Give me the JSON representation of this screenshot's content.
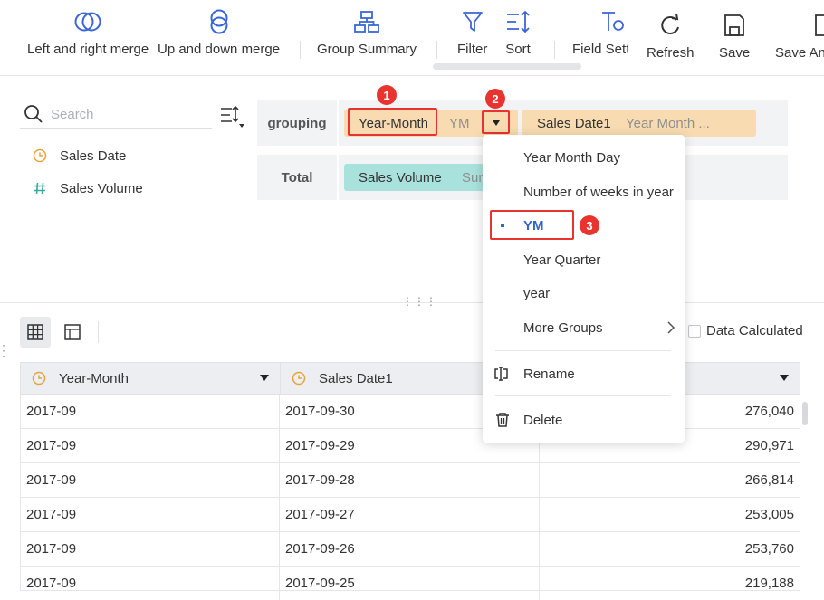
{
  "toolbar": {
    "items": [
      {
        "label": "Left and right merge",
        "icon": "left-right-merge-icon"
      },
      {
        "label": "Up and down merge",
        "icon": "up-down-merge-icon"
      },
      {
        "label": "Group Summary",
        "icon": "group-summary-icon"
      },
      {
        "label": "Filter",
        "icon": "filter-icon"
      },
      {
        "label": "Sort",
        "icon": "sort-icon"
      },
      {
        "label": "Field Setti",
        "icon": "field-settings-icon"
      },
      {
        "label": "Refresh",
        "icon": "refresh-icon"
      },
      {
        "label": "Save",
        "icon": "save-icon"
      },
      {
        "label": "Save An",
        "icon": "save-as-icon"
      }
    ]
  },
  "field_panel": {
    "search_placeholder": "Search",
    "fields": [
      {
        "label": "Sales Date",
        "icon": "clock-icon",
        "color": "#e8a33d"
      },
      {
        "label": "Sales Volume",
        "icon": "hash-icon",
        "color": "#3aa99f"
      }
    ]
  },
  "grouping": {
    "label": "grouping",
    "chips": [
      {
        "name": "Year-Month",
        "sub": "YM"
      },
      {
        "name": "Sales Date1",
        "sub": "Year Month ..."
      }
    ]
  },
  "total": {
    "label": "Total",
    "chips": [
      {
        "name": "Sales Volume",
        "sub": "Sum"
      }
    ]
  },
  "annotations": {
    "one": "1",
    "two": "2",
    "three": "3"
  },
  "data_calculated": "Data Calculated",
  "dropdown": {
    "items": [
      {
        "label": "Year Month Day"
      },
      {
        "label": "Number of weeks in year"
      },
      {
        "label": "YM",
        "selected": true
      },
      {
        "label": "Year Quarter"
      },
      {
        "label": "year"
      },
      {
        "label": "More Groups"
      }
    ],
    "rename": "Rename",
    "delete": "Delete"
  },
  "table": {
    "columns": [
      "Year-Month",
      "Sales Date1",
      ""
    ],
    "rows": [
      [
        "2017-09",
        "2017-09-30",
        "276,040"
      ],
      [
        "2017-09",
        "2017-09-29",
        "290,971"
      ],
      [
        "2017-09",
        "2017-09-28",
        "266,814"
      ],
      [
        "2017-09",
        "2017-09-27",
        "253,005"
      ],
      [
        "2017-09",
        "2017-09-26",
        "253,760"
      ],
      [
        "2017-09",
        "2017-09-25",
        "219,188"
      ]
    ]
  },
  "colors": {
    "accent": "#3366cc",
    "highlight": "#e8332f",
    "chip_orange": "#f8dbb0",
    "chip_teal": "#a9e2dc"
  }
}
